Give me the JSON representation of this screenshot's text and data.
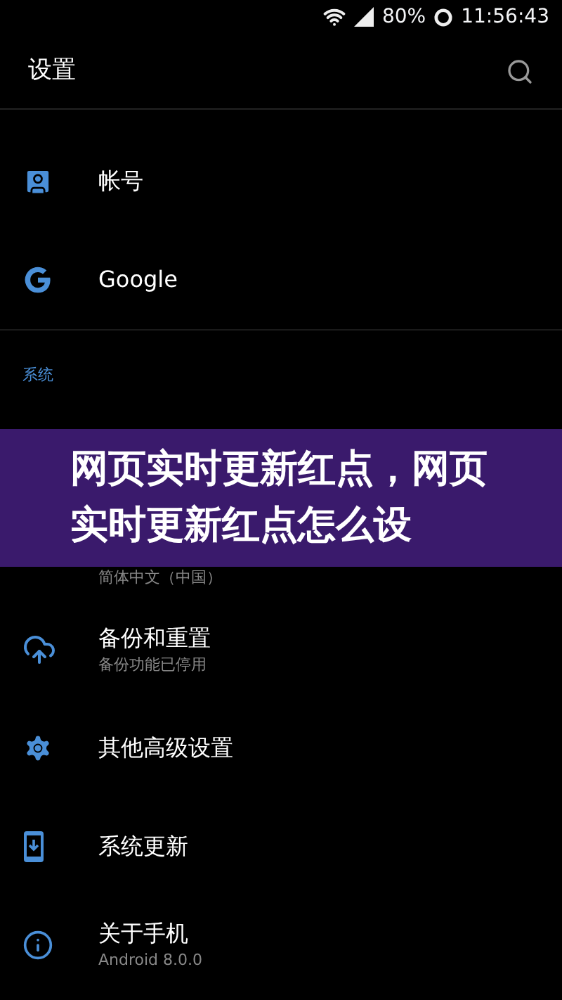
{
  "status_bar": {
    "battery": "80%",
    "time": "11:56:43"
  },
  "toolbar": {
    "title": "设置"
  },
  "sections": [
    {
      "items": [
        {
          "title": "帐号"
        },
        {
          "title": "Google"
        }
      ]
    },
    {
      "header": "系统",
      "banner": "网页实时更新红点，网页实时更新红点怎么设",
      "items": [
        {
          "subtitle": "简体中文（中国）"
        },
        {
          "title": "备份和重置",
          "subtitle": "备份功能已停用"
        },
        {
          "title": "其他高级设置"
        },
        {
          "title": "系统更新"
        },
        {
          "title": "关于手机",
          "subtitle": "Android 8.0.0"
        }
      ]
    }
  ]
}
